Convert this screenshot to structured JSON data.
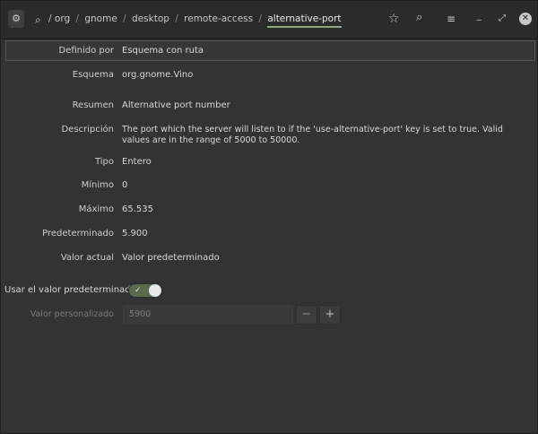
{
  "header": {
    "app_icon": "dconf-app-icon",
    "path_icon": "search-icon",
    "path": [
      "org",
      "gnome",
      "desktop",
      "remote-access"
    ],
    "path_last": "alternative-port",
    "separator": "/",
    "buttons": {
      "star": "☆",
      "search": "⌕",
      "menu": "≡",
      "minimize": "‒",
      "maximize": "⤢",
      "close": "✕"
    }
  },
  "properties": [
    {
      "label": "Definido por",
      "value": "Esquema con ruta"
    },
    {
      "label": "Esquema",
      "value": "org.gnome.Vino"
    },
    {
      "label": "Resumen",
      "value": "Alternative port number"
    },
    {
      "label": "Descripción",
      "value": "The port which the server will listen to if the 'use-alternative-port' key is set to true. Valid values are in the range of 5000 to 50000."
    },
    {
      "label": "Tipo",
      "value": "Entero"
    },
    {
      "label": "Mínimo",
      "value": "0"
    },
    {
      "label": "Máximo",
      "value": "65.535"
    },
    {
      "label": "Predeterminado",
      "value": "5.900"
    },
    {
      "label": "Valor actual",
      "value": "Valor predeterminado"
    }
  ],
  "use_default": {
    "label": "Usar el valor predeterminado",
    "state": true,
    "check": "✓"
  },
  "custom": {
    "label": "Valor personalizado",
    "value": "5900",
    "minus": "−",
    "plus": "+"
  },
  "colors": {
    "accent": "#8fa87e",
    "background": "#333333"
  }
}
